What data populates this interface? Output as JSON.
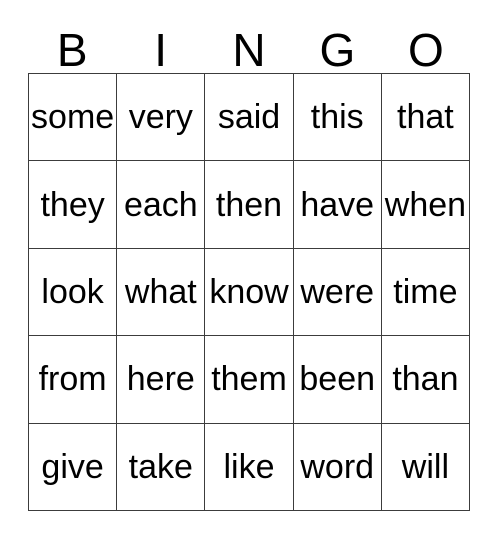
{
  "card": {
    "title": "BINGO",
    "header_letters": [
      "B",
      "I",
      "N",
      "G",
      "O"
    ],
    "colors": {
      "background": "#ffffff",
      "text": "#000000",
      "grid_line": "#3c3c3c"
    },
    "rows": [
      [
        "some",
        "very",
        "said",
        "this",
        "that"
      ],
      [
        "they",
        "each",
        "then",
        "have",
        "when"
      ],
      [
        "look",
        "what",
        "know",
        "were",
        "time"
      ],
      [
        "from",
        "here",
        "them",
        "been",
        "than"
      ],
      [
        "give",
        "take",
        "like",
        "word",
        "will"
      ]
    ]
  }
}
